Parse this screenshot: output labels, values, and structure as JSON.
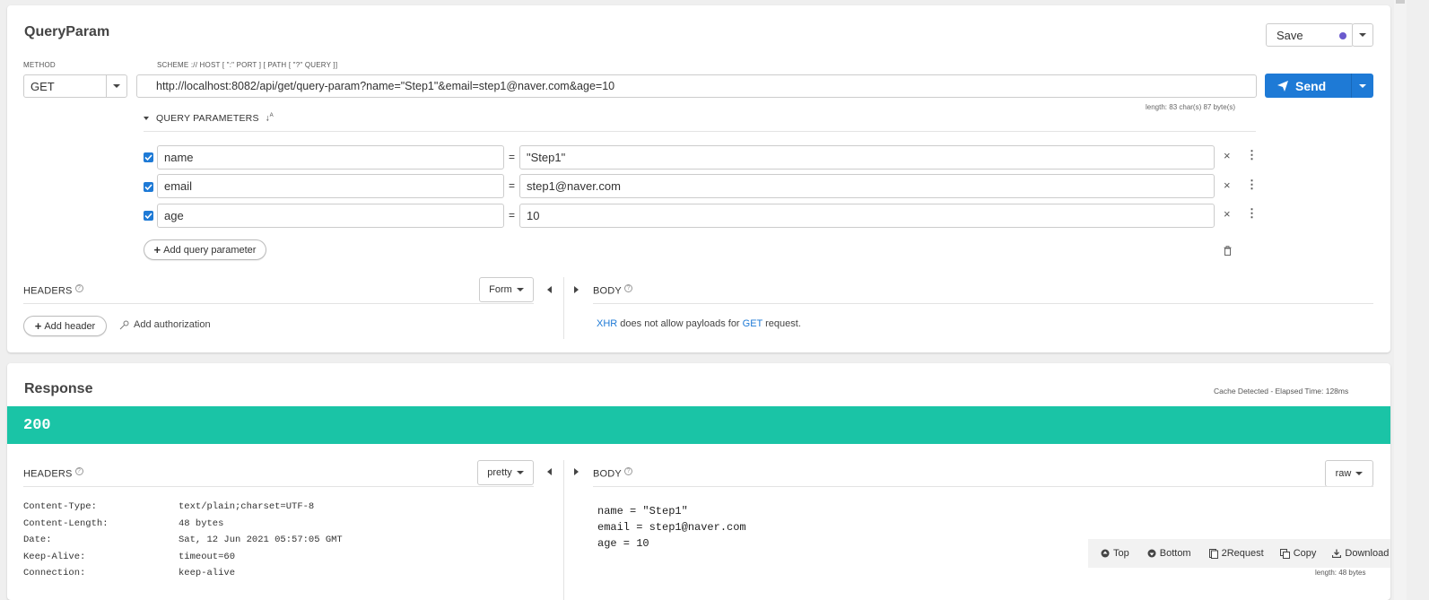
{
  "request": {
    "title": "QueryParam",
    "save_label": "Save",
    "method_label": "METHOD",
    "method": "GET",
    "scheme_label": "SCHEME :// HOST [ \":\" PORT ] [ PATH [ \"?\" QUERY ]]",
    "url": "http://localhost:8082/api/get/query-param?name=\"Step1\"&email=step1@naver.com&age=10",
    "send_label": "Send",
    "length_info": "length: 83 char(s) 87 byte(s)",
    "query_params_label": "QUERY PARAMETERS",
    "params": [
      {
        "key": "name",
        "value": "\"Step1\"",
        "checked": true
      },
      {
        "key": "email",
        "value": "step1@naver.com",
        "checked": true
      },
      {
        "key": "age",
        "value": "10",
        "checked": true
      }
    ],
    "equals": "=",
    "add_param_label": "Add query parameter",
    "headers_label": "HEADERS",
    "form_label": "Form",
    "add_header_label": "Add header",
    "add_auth_label": "Add authorization",
    "body_label": "BODY",
    "body_msg": {
      "xhr": "XHR",
      "mid": " does not allow payloads for ",
      "get": "GET",
      "end": " request."
    }
  },
  "response": {
    "title": "Response",
    "cache_info": "Cache Detected - Elapsed Time: 128ms",
    "status": "200",
    "headers_label": "HEADERS",
    "pretty_label": "pretty",
    "body_label": "BODY",
    "raw_label": "raw",
    "headers": [
      {
        "name": "Content-Type:",
        "value": "text/plain;charset=UTF-8"
      },
      {
        "name": "Content-Length:",
        "value": "48 bytes"
      },
      {
        "name": "Date:",
        "value": "Sat, 12 Jun 2021 05:57:05 GMT"
      },
      {
        "name": "Keep-Alive:",
        "value": "timeout=60"
      },
      {
        "name": "Connection:",
        "value": "keep-alive"
      }
    ],
    "body_lines": [
      "name = \"Step1\"",
      "email = step1@naver.com",
      "age = 10"
    ],
    "toolbar": {
      "top": "Top",
      "bottom": "Bottom",
      "request": "2Request",
      "copy": "Copy",
      "download": "Download"
    },
    "length_info": "length: 48 bytes"
  },
  "colors": {
    "accent": "#1e7ad6",
    "status_ok": "#1ac4a6",
    "dot": "#6a5acd"
  }
}
